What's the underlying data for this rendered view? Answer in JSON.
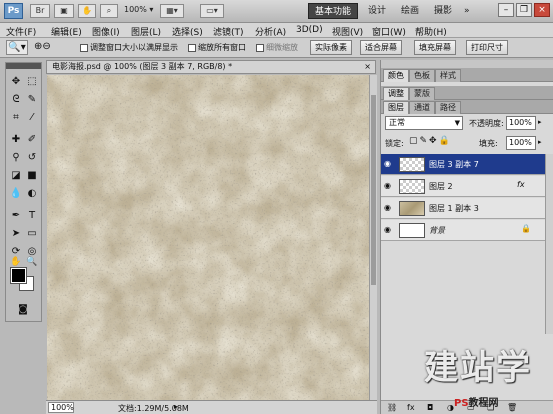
{
  "app": {
    "logo": "Ps",
    "zoom": "100%",
    "workspaces": [
      "基本功能",
      "设计",
      "绘画",
      "摄影"
    ],
    "active_workspace": "基本功能",
    "more": "»"
  },
  "menu": [
    "文件(F)",
    "编辑(E)",
    "图像(I)",
    "图层(L)",
    "选择(S)",
    "滤镜(T)",
    "分析(A)",
    "3D(D)",
    "视图(V)",
    "窗口(W)",
    "帮助(H)"
  ],
  "options": {
    "check_resize": "调整窗口大小以满屏显示",
    "check_zoom_all": "缩放所有窗口",
    "check_scrubby": "细微缩放",
    "btn_actual": "实际像素",
    "btn_fit": "适合屏幕",
    "btn_fill": "填充屏幕",
    "btn_print": "打印尺寸"
  },
  "document": {
    "tab_title": "电影海报.psd @ 100% (图层 3 副本 7, RGB/8) *",
    "close": "×",
    "status_zoom": "100%",
    "status_doc": "文档:1.29M/5.08M"
  },
  "panels": {
    "top_tabs": [
      "颜色",
      "色板",
      "样式"
    ],
    "mid_tabs": [
      "调整",
      "蒙版"
    ],
    "layer_tabs": [
      "图层",
      "通道",
      "路径"
    ],
    "blend_mode": "正常",
    "opacity_label": "不透明度:",
    "opacity_value": "100%",
    "lock_label": "锁定:",
    "fill_label": "填充:",
    "fill_value": "100%",
    "layers": [
      {
        "name": "图层 3 副本 7",
        "selected": true
      },
      {
        "name": "图层 2",
        "fx": "fx"
      },
      {
        "name": "图层 1 副本 3"
      },
      {
        "name": "背景",
        "locked": true
      }
    ]
  },
  "watermark": {
    "main": "建站学",
    "sub_ps": "PS",
    "sub_rest": "教程网"
  }
}
